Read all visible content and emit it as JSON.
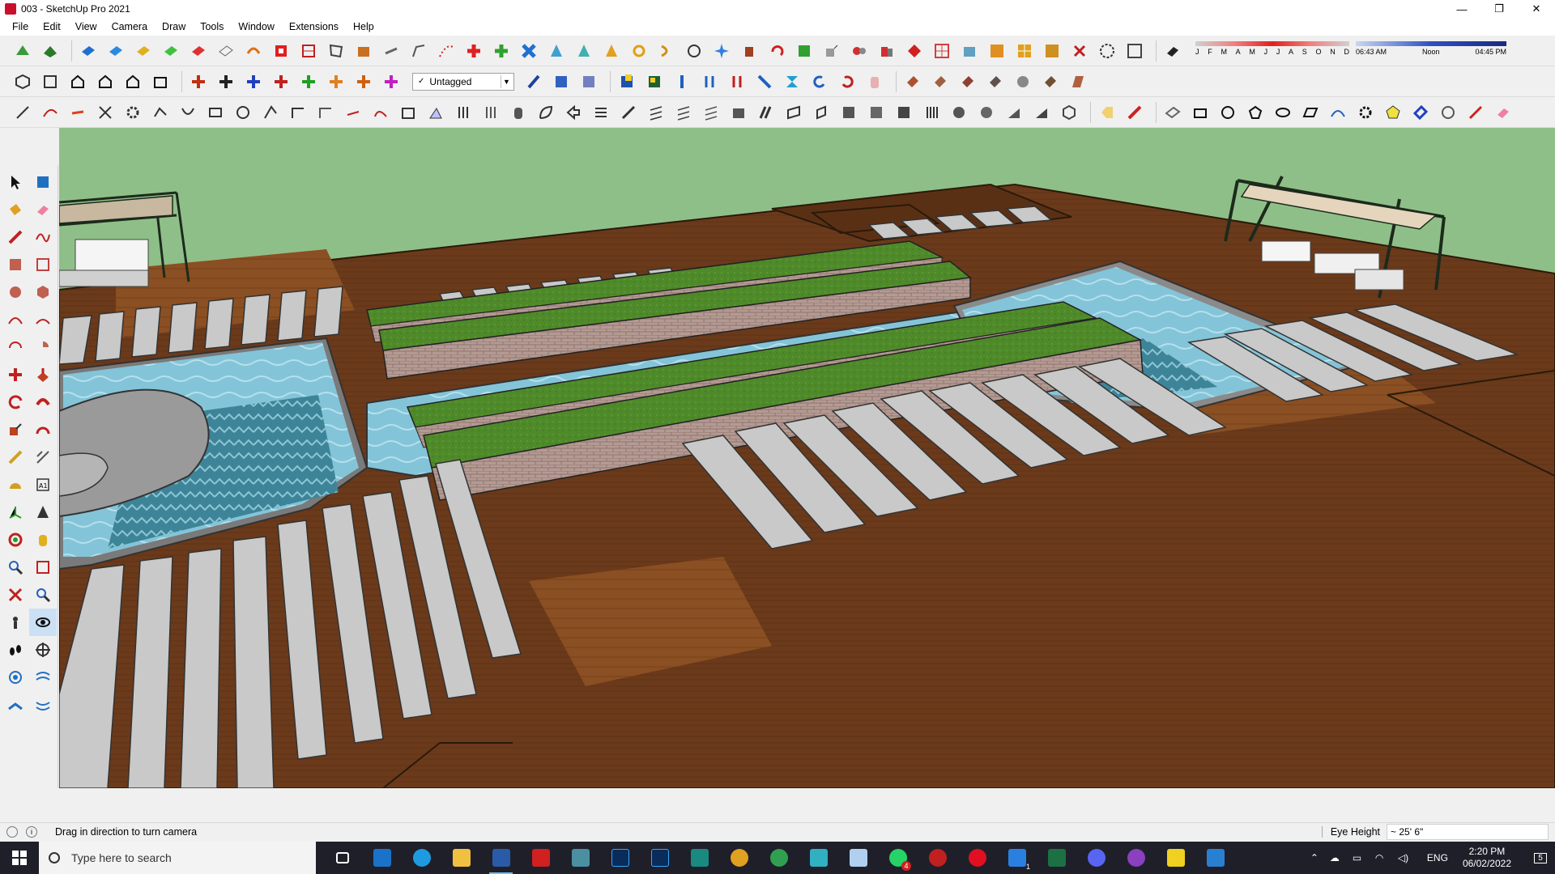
{
  "window": {
    "title": "003 - SketchUp Pro 2021",
    "minimize_glyph": "—",
    "restore_glyph": "❐",
    "close_glyph": "✕"
  },
  "menu": [
    "File",
    "Edit",
    "View",
    "Camera",
    "Draw",
    "Tools",
    "Window",
    "Extensions",
    "Help"
  ],
  "tag_selector": {
    "value": "Untagged",
    "check": "✓"
  },
  "shadow": {
    "months": [
      "J",
      "F",
      "M",
      "A",
      "M",
      "J",
      "J",
      "A",
      "S",
      "O",
      "N",
      "D"
    ],
    "sunrise": "06:43 AM",
    "noon": "Noon",
    "sunset": "04:45 PM"
  },
  "status": {
    "message": "Drag in direction to turn camera",
    "measure_label": "Eye Height",
    "measure_value": "~ 25' 6\""
  },
  "taskbar": {
    "search_placeholder": "Type here to search",
    "language": "ENG",
    "time": "2:20 PM",
    "date": "06/02/2022",
    "notification_count": "5",
    "whatsapp_badge": "4",
    "todo_badge": "1"
  },
  "colors": {
    "sky": "#8fbf88",
    "deck": "#6b3a1b",
    "grass": "#4f8a2a",
    "water": "#7fc3d6",
    "stone": "#c9c9c9",
    "brick": "#b49a92"
  }
}
